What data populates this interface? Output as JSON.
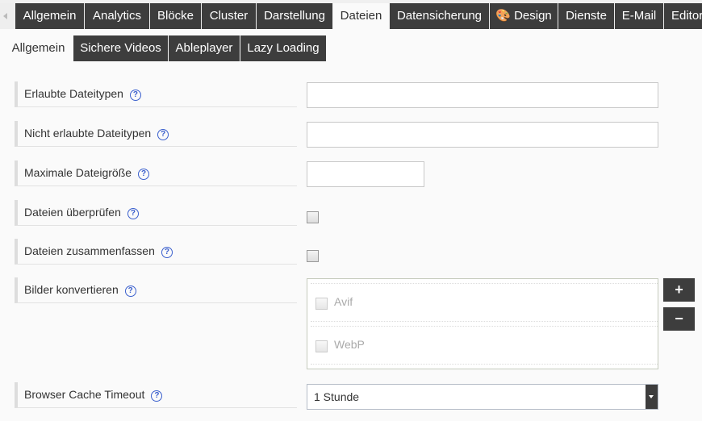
{
  "main_tabs": [
    {
      "label": "Allgemein"
    },
    {
      "label": "Analytics"
    },
    {
      "label": "Blöcke"
    },
    {
      "label": "Cluster"
    },
    {
      "label": "Darstellung"
    },
    {
      "label": "Dateien",
      "active": true
    },
    {
      "label": "Datensicherung"
    },
    {
      "label": "🎨 Design"
    },
    {
      "label": "Dienste"
    },
    {
      "label": "E-Mail"
    },
    {
      "label": "Editor"
    }
  ],
  "sub_tabs": [
    {
      "label": "Allgemein",
      "active": true
    },
    {
      "label": "Sichere Videos"
    },
    {
      "label": "Ableplayer"
    },
    {
      "label": "Lazy Loading"
    }
  ],
  "fields": {
    "allowed": {
      "label": "Erlaubte Dateitypen",
      "value": ""
    },
    "disallowed": {
      "label": "Nicht erlaubte Dateitypen",
      "value": ""
    },
    "maxsize": {
      "label": "Maximale Dateigröße",
      "value": ""
    },
    "check": {
      "label": "Dateien überprüfen",
      "checked": false
    },
    "merge": {
      "label": "Dateien zusammenfassen",
      "checked": false
    },
    "convert": {
      "label": "Bilder konvertieren",
      "options": [
        {
          "label": "Avif",
          "checked": false
        },
        {
          "label": "WebP",
          "checked": false
        }
      ],
      "add": "+",
      "remove": "−"
    },
    "cache": {
      "label": "Browser Cache Timeout",
      "value": "1 Stunde"
    }
  },
  "help_glyph": "?"
}
